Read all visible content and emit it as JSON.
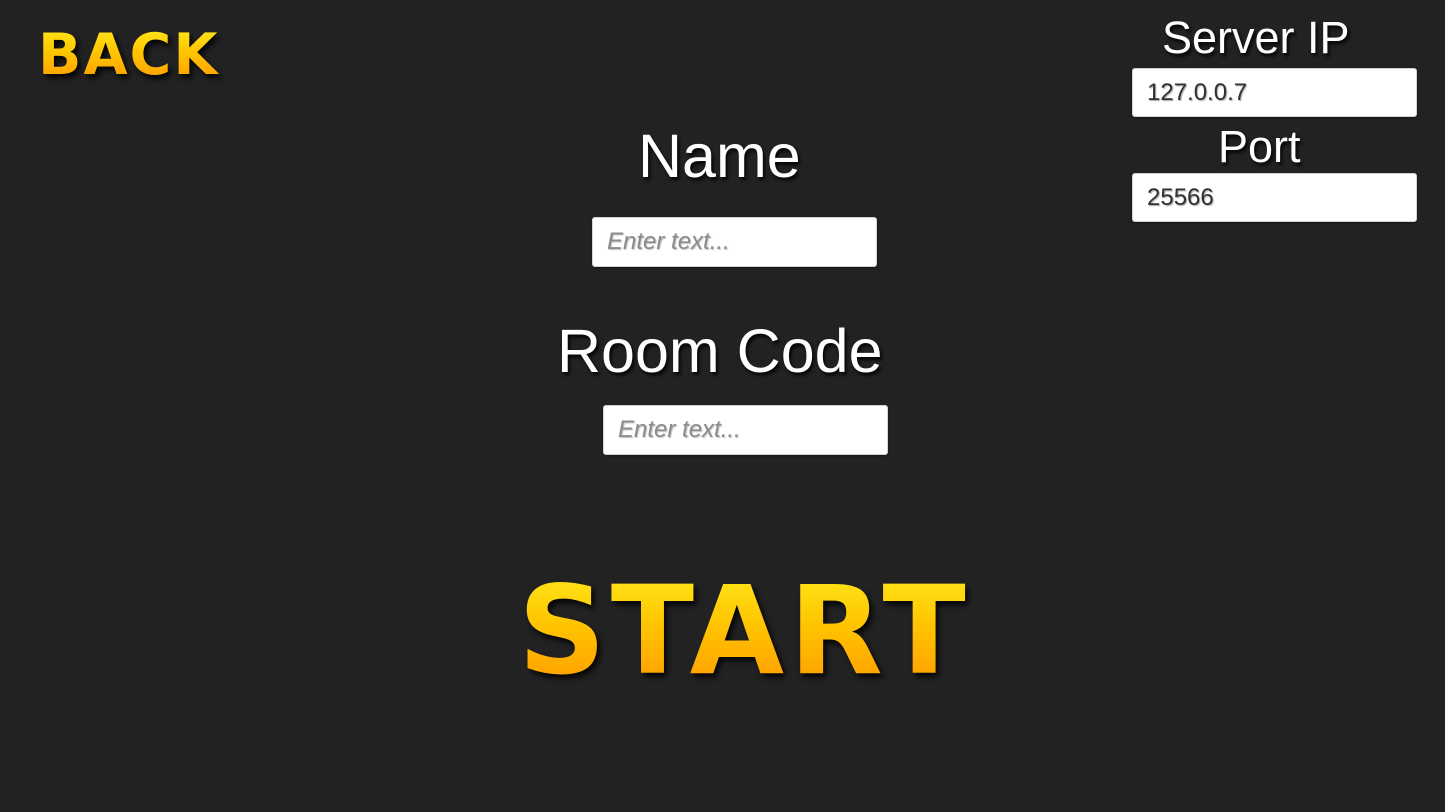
{
  "navigation": {
    "back_label": "BACK"
  },
  "form": {
    "name": {
      "label": "Name",
      "value": "",
      "placeholder": "Enter text..."
    },
    "room_code": {
      "label": "Room Code",
      "value": "",
      "placeholder": "Enter text..."
    }
  },
  "server": {
    "ip_label": "Server IP",
    "ip_value": "127.0.0.7",
    "port_label": "Port",
    "port_value": "25566"
  },
  "actions": {
    "start_label": "START"
  },
  "colors": {
    "background": "#222222",
    "accent_gold_top": "#ffe81a",
    "accent_gold_bottom": "#ff9a00",
    "label_text": "#ffffff",
    "field_background": "#ffffff"
  }
}
